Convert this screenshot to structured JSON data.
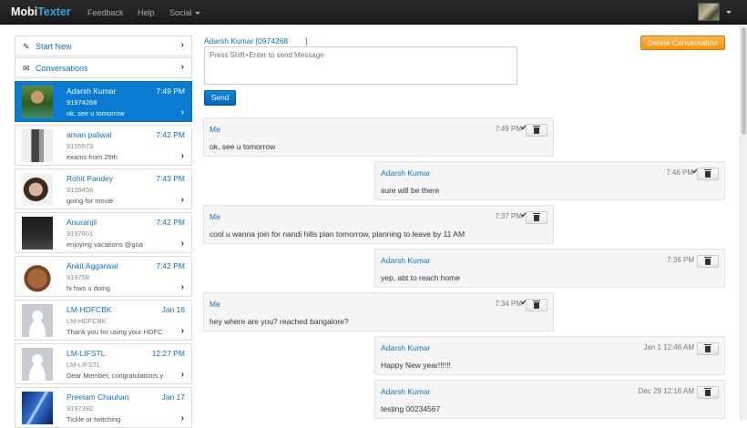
{
  "nav": {
    "brand_a": "Mobi",
    "brand_b": "Texter",
    "links": [
      "Feedback",
      "Help",
      "Social"
    ]
  },
  "sidebar": {
    "start_new": "Start New",
    "conversations": "Conversations",
    "items": [
      {
        "name": "Adarsh Kumar",
        "time": "7:49 PM",
        "number": "91974268",
        "snippet": "ok, see u tomorrow",
        "active": true
      },
      {
        "name": "aman paliwal",
        "time": "7:42 PM",
        "number": "9105573",
        "snippet": "exams from 29th"
      },
      {
        "name": "Rohit Pandey",
        "time": "7:43 PM",
        "number": "9109456",
        "snippet": "going for movie"
      },
      {
        "name": "Anuranjil",
        "time": "7:42 PM",
        "number": "9197601",
        "snippet": "enjoying vacations @goa"
      },
      {
        "name": "Ankit Aggarwal",
        "time": "7:42 PM",
        "number": "919758",
        "snippet": "hi hws u doing"
      },
      {
        "name": "LM-HDFCBK",
        "time": "Jan 16",
        "number": "LM-HDFCBK",
        "snippet": "Thank you for using your HDFC"
      },
      {
        "name": "LM-LIFSTL",
        "time": "12:27 PM",
        "number": "LM-LIFSTL",
        "snippet": "Dear Member, congratulations y"
      },
      {
        "name": "Preelam Chauhan",
        "time": "Jan 17",
        "number": "9197392",
        "snippet": "Tickle or twitching"
      }
    ]
  },
  "compose": {
    "recipient": "Adarsh Kumar [0974268        ]",
    "placeholder": "Press Shift+Enter to send Message",
    "send_label": "Send",
    "delete_label": "Delete Conversation"
  },
  "messages": [
    {
      "sender": "Me",
      "time": "7:49 PM",
      "text": "ok, see u tomorrow",
      "from_me": true,
      "delivered": true
    },
    {
      "sender": "Adarsh Kumar",
      "time": "7:46 PM",
      "text": "sure will be there",
      "from_me": false,
      "delivered": true
    },
    {
      "sender": "Me",
      "time": "7:37 PM",
      "text": "cool u wanna join for nandi hills plan tomorrow, planning to leave by 11 AM",
      "from_me": true,
      "delivered": true
    },
    {
      "sender": "Adarsh Kumar",
      "time": "7:36 PM",
      "text": "yep, abt to reach home",
      "from_me": false,
      "delivered": false
    },
    {
      "sender": "Me",
      "time": "7:34 PM",
      "text": "hey where are you? reached bangalore?",
      "from_me": true,
      "delivered": true
    },
    {
      "sender": "Adarsh Kumar",
      "time": "Jan 1 12:46 AM",
      "text": "Happy New year!!!!!!",
      "from_me": false,
      "delivered": false
    },
    {
      "sender": "Adarsh Kumar",
      "time": "Dec 29 12:16 AM",
      "text": "testing 00234567",
      "from_me": false,
      "delivered": false
    }
  ],
  "colors": {
    "accent": "#0a7bd2",
    "warning": "#f89406",
    "navbar": "#222222"
  }
}
